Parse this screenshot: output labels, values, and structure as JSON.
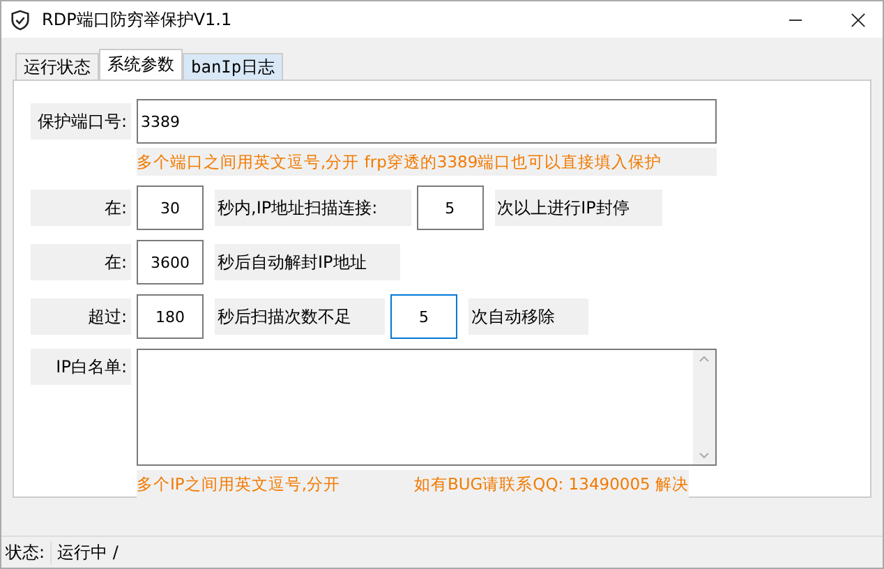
{
  "window": {
    "title": "RDP端口防穷举保护V1.1"
  },
  "tabs": [
    {
      "label": "运行状态",
      "selected": false
    },
    {
      "label": "系统参数",
      "selected": true
    },
    {
      "label": "banIp日志",
      "selected": false
    }
  ],
  "port": {
    "label": "保护端口号:",
    "value": "3389",
    "hint": "多个端口之间用英文逗号,分开  frp穿透的3389端口也可以直接填入保护"
  },
  "rules": [
    {
      "label": "在:",
      "parts": [
        {
          "kind": "input",
          "value": "30",
          "focused": false
        },
        {
          "kind": "text",
          "text": "秒内,IP地址扫描连接:"
        },
        {
          "kind": "input",
          "value": "5",
          "focused": false
        },
        {
          "kind": "text",
          "text": "次以上进行IP封停"
        }
      ]
    },
    {
      "label": "在:",
      "parts": [
        {
          "kind": "input",
          "value": "3600",
          "focused": false
        },
        {
          "kind": "text",
          "text": "秒后自动解封IP地址"
        }
      ]
    },
    {
      "label": "超过:",
      "parts": [
        {
          "kind": "input",
          "value": "180",
          "focused": false
        },
        {
          "kind": "text",
          "text": "秒后扫描次数不足"
        },
        {
          "kind": "input",
          "value": "5",
          "focused": true
        },
        {
          "kind": "text",
          "text": "次自动移除"
        }
      ]
    }
  ],
  "whitelist": {
    "label": "IP白名单:",
    "hint_left": "多个IP之间用英文逗号,分开",
    "hint_right": "如有BUG请联系QQ: 13490005 解决"
  },
  "status_bar": {
    "label": "状态:",
    "value": "运行中 /"
  }
}
